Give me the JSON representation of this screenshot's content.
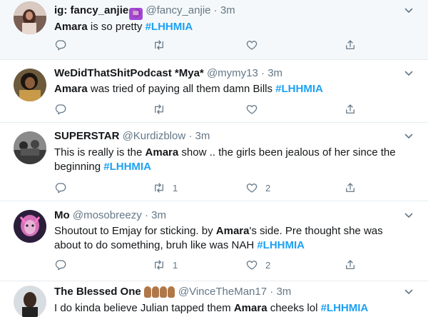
{
  "tweets": [
    {
      "name": "ig: fancy_anjie",
      "badge": "♒",
      "handle": "@fancy_anjie",
      "time": "3m",
      "text": {
        "bold": "Amara",
        "rest": " is so pretty ",
        "tag": "#LHHMIA"
      },
      "retweets": "",
      "likes": ""
    },
    {
      "name": "WeDidThatShitPodcast *Mya*",
      "handle": "@mymy13",
      "time": "3m",
      "text": {
        "bold": "Amara",
        "rest": " was tried of paying all them damn Bills ",
        "tag": "#LHHMIA"
      },
      "retweets": "",
      "likes": ""
    },
    {
      "name": "SUPERSTAR",
      "handle": "@Kurdizblow",
      "time": "3m",
      "text": {
        "pre": "This is really is the ",
        "bold": "Amara",
        "rest": " show .. the girls been jealous of her since the beginning  ",
        "tag": "#LHHMIA"
      },
      "retweets": "1",
      "likes": "2"
    },
    {
      "name": "Mo",
      "handle": "@mosobreezy",
      "time": "3m",
      "text": {
        "pre": "Shoutout to Emjay for sticking. by ",
        "bold": "Amara",
        "rest": "'s side. Pre thought she was about to do something, bruh like was NAH ",
        "tag": "#LHHMIA"
      },
      "retweets": "1",
      "likes": "2"
    },
    {
      "name": "The Blessed One",
      "handle": "@VinceTheMan17",
      "time": "3m",
      "text": {
        "pre": "I do kinda believe Julian tapped them ",
        "bold": "Amara",
        "rest": " cheeks lol ",
        "tag": "#LHHMIA"
      },
      "retweets": "",
      "likes": ""
    }
  ],
  "dot": "·",
  "colors": {
    "link": "#1da1f2",
    "muted": "#657786",
    "divider": "#e6ecf0",
    "hover_bg": "#f5f8fa"
  },
  "icons": [
    "reply-icon",
    "retweet-icon",
    "like-icon",
    "share-icon",
    "chevron-down-icon"
  ]
}
